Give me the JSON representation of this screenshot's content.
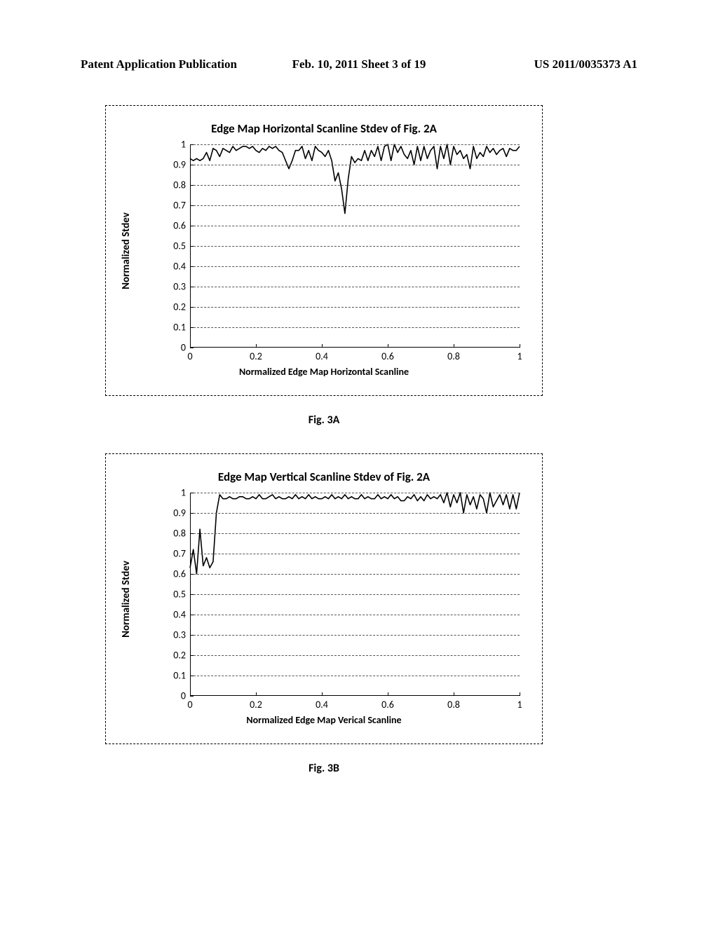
{
  "header": {
    "left": "Patent Application Publication",
    "center": "Feb. 10, 2011  Sheet 3 of 19",
    "right": "US 2011/0035373 A1"
  },
  "figA": {
    "caption": "Fig. 3A"
  },
  "figB": {
    "caption": "Fig. 3B"
  },
  "chart_data": [
    {
      "type": "line",
      "title": "Edge Map Horizontal Scanline Stdev of Fig. 2A",
      "xlabel": "Normalized Edge Map Horizontal Scanline",
      "ylabel": "Normalized Stdev",
      "xlim": [
        0,
        1
      ],
      "ylim": [
        0,
        1
      ],
      "xticks": [
        0,
        0.2,
        0.4,
        0.6,
        0.8,
        1
      ],
      "yticks": [
        0,
        0.1,
        0.2,
        0.3,
        0.4,
        0.5,
        0.6,
        0.7,
        0.8,
        0.9,
        1
      ],
      "series": [
        {
          "name": "stdev",
          "x": [
            0,
            0.01,
            0.02,
            0.03,
            0.04,
            0.05,
            0.06,
            0.07,
            0.08,
            0.09,
            0.1,
            0.11,
            0.12,
            0.13,
            0.14,
            0.15,
            0.16,
            0.17,
            0.18,
            0.19,
            0.2,
            0.21,
            0.22,
            0.23,
            0.24,
            0.25,
            0.26,
            0.27,
            0.28,
            0.29,
            0.3,
            0.31,
            0.32,
            0.33,
            0.34,
            0.35,
            0.36,
            0.37,
            0.38,
            0.39,
            0.4,
            0.41,
            0.42,
            0.43,
            0.44,
            0.45,
            0.46,
            0.47,
            0.48,
            0.49,
            0.5,
            0.51,
            0.52,
            0.53,
            0.54,
            0.55,
            0.56,
            0.57,
            0.58,
            0.59,
            0.6,
            0.61,
            0.62,
            0.63,
            0.64,
            0.65,
            0.66,
            0.67,
            0.68,
            0.69,
            0.7,
            0.71,
            0.72,
            0.73,
            0.74,
            0.75,
            0.76,
            0.77,
            0.78,
            0.79,
            0.8,
            0.81,
            0.82,
            0.83,
            0.84,
            0.85,
            0.86,
            0.87,
            0.88,
            0.89,
            0.9,
            0.91,
            0.92,
            0.93,
            0.94,
            0.95,
            0.96,
            0.97,
            0.98,
            0.99,
            1.0
          ],
          "y": [
            0.93,
            0.92,
            0.93,
            0.92,
            0.93,
            0.96,
            0.92,
            0.98,
            0.97,
            0.94,
            0.98,
            0.97,
            0.96,
            0.99,
            0.97,
            0.98,
            0.99,
            0.99,
            0.98,
            0.99,
            0.97,
            0.96,
            0.98,
            0.97,
            0.99,
            0.98,
            0.99,
            0.97,
            0.96,
            0.92,
            0.88,
            0.92,
            0.97,
            0.97,
            0.99,
            0.93,
            0.97,
            0.92,
            0.99,
            0.97,
            0.96,
            0.94,
            0.97,
            0.92,
            0.82,
            0.86,
            0.78,
            0.66,
            0.83,
            0.94,
            0.91,
            0.93,
            0.92,
            0.97,
            0.92,
            0.97,
            0.94,
            0.99,
            0.92,
            0.99,
            1.0,
            0.92,
            1.0,
            0.96,
            0.99,
            0.95,
            0.93,
            0.97,
            0.9,
            0.99,
            0.92,
            0.99,
            0.93,
            0.97,
            0.99,
            0.88,
            0.99,
            0.93,
            1.0,
            0.9,
            0.99,
            0.95,
            0.97,
            0.93,
            0.95,
            0.88,
            0.99,
            0.93,
            0.96,
            0.94,
            0.99,
            0.96,
            0.98,
            0.95,
            0.97,
            0.98,
            0.94,
            0.98,
            0.97,
            0.97,
            0.99
          ]
        }
      ]
    },
    {
      "type": "line",
      "title": "Edge Map Vertical Scanline Stdev of Fig. 2A",
      "xlabel": "Normalized Edge Map Verical Scanline",
      "ylabel": "Normalized Stdev",
      "xlim": [
        0,
        1
      ],
      "ylim": [
        0,
        1
      ],
      "xticks": [
        0,
        0.2,
        0.4,
        0.6,
        0.8,
        1
      ],
      "yticks": [
        0,
        0.1,
        0.2,
        0.3,
        0.4,
        0.5,
        0.6,
        0.7,
        0.8,
        0.9,
        1
      ],
      "series": [
        {
          "name": "stdev",
          "x": [
            0,
            0.01,
            0.02,
            0.03,
            0.04,
            0.05,
            0.06,
            0.07,
            0.08,
            0.09,
            0.1,
            0.11,
            0.12,
            0.13,
            0.14,
            0.15,
            0.16,
            0.17,
            0.18,
            0.19,
            0.2,
            0.21,
            0.22,
            0.23,
            0.24,
            0.25,
            0.26,
            0.27,
            0.28,
            0.29,
            0.3,
            0.31,
            0.32,
            0.33,
            0.34,
            0.35,
            0.36,
            0.37,
            0.38,
            0.39,
            0.4,
            0.41,
            0.42,
            0.43,
            0.44,
            0.45,
            0.46,
            0.47,
            0.48,
            0.49,
            0.5,
            0.51,
            0.52,
            0.53,
            0.54,
            0.55,
            0.56,
            0.57,
            0.58,
            0.59,
            0.6,
            0.61,
            0.62,
            0.63,
            0.64,
            0.65,
            0.66,
            0.67,
            0.68,
            0.69,
            0.7,
            0.71,
            0.72,
            0.73,
            0.74,
            0.75,
            0.76,
            0.77,
            0.78,
            0.79,
            0.8,
            0.81,
            0.82,
            0.83,
            0.84,
            0.85,
            0.86,
            0.87,
            0.88,
            0.89,
            0.9,
            0.91,
            0.92,
            0.93,
            0.94,
            0.95,
            0.96,
            0.97,
            0.98,
            0.99,
            1.0
          ],
          "y": [
            0.63,
            0.72,
            0.6,
            0.82,
            0.64,
            0.68,
            0.63,
            0.66,
            0.9,
            0.99,
            0.97,
            0.97,
            0.98,
            0.97,
            0.97,
            0.98,
            0.98,
            0.97,
            0.97,
            0.98,
            0.97,
            0.99,
            0.97,
            0.97,
            0.98,
            0.99,
            0.97,
            0.98,
            0.97,
            0.97,
            0.98,
            0.97,
            0.99,
            0.97,
            0.98,
            0.97,
            0.99,
            0.97,
            0.98,
            0.97,
            0.97,
            0.98,
            0.97,
            0.99,
            0.97,
            0.98,
            0.97,
            0.99,
            0.97,
            0.98,
            0.97,
            0.97,
            0.99,
            0.97,
            0.98,
            0.97,
            0.97,
            0.99,
            0.97,
            0.98,
            0.97,
            0.99,
            0.97,
            0.98,
            0.96,
            0.96,
            0.98,
            0.97,
            0.99,
            0.96,
            0.98,
            0.96,
            0.99,
            0.97,
            0.98,
            0.97,
            0.99,
            0.95,
            1.0,
            0.93,
            0.99,
            0.95,
            1.0,
            0.9,
            0.99,
            0.94,
            0.98,
            0.92,
            0.99,
            0.97,
            0.9,
            1.0,
            0.93,
            0.96,
            0.99,
            0.94,
            0.99,
            0.92,
            0.99,
            0.92,
            1.0
          ]
        }
      ]
    }
  ]
}
